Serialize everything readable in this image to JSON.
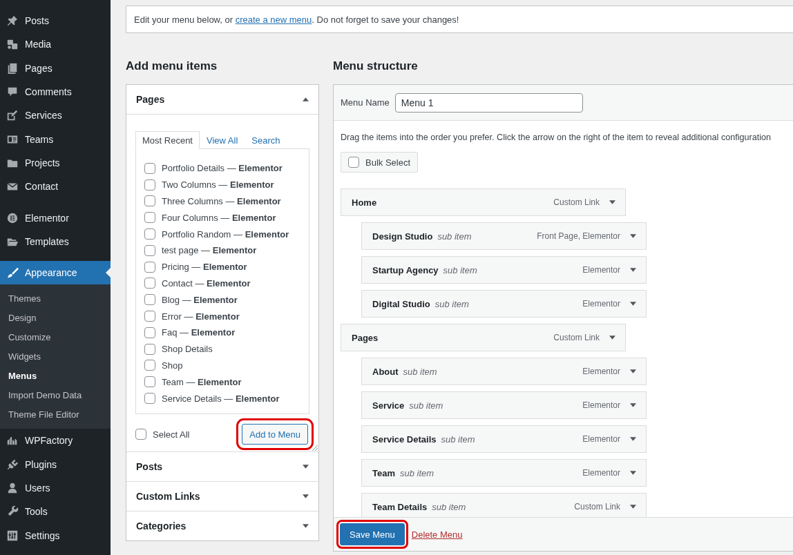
{
  "sidebar": {
    "groups": [
      {
        "items": [
          {
            "label": "Posts",
            "selected": false
          },
          {
            "label": "Media",
            "selected": false
          },
          {
            "label": "Pages",
            "selected": false
          },
          {
            "label": "Comments",
            "selected": false
          },
          {
            "label": "Services",
            "selected": false
          },
          {
            "label": "Teams",
            "selected": false
          },
          {
            "label": "Projects",
            "selected": false
          },
          {
            "label": "Contact",
            "selected": false
          }
        ]
      },
      {
        "items": [
          {
            "label": "Elementor",
            "selected": false
          },
          {
            "label": "Templates",
            "selected": false
          }
        ]
      },
      {
        "items": [
          {
            "label": "Appearance",
            "selected": true,
            "children": [
              {
                "label": "Themes",
                "selected": false
              },
              {
                "label": "Design",
                "selected": false
              },
              {
                "label": "Customize",
                "selected": false
              },
              {
                "label": "Widgets",
                "selected": false
              },
              {
                "label": "Menus",
                "selected": true
              },
              {
                "label": "Import Demo Data",
                "selected": false
              },
              {
                "label": "Theme File Editor",
                "selected": false
              }
            ]
          },
          {
            "label": "WPFactory",
            "selected": false
          },
          {
            "label": "Plugins",
            "selected": false
          },
          {
            "label": "Users",
            "selected": false
          },
          {
            "label": "Tools",
            "selected": false
          },
          {
            "label": "Settings",
            "selected": false
          }
        ]
      }
    ]
  },
  "notice": {
    "before": "Edit your menu below, or ",
    "link": "create a new menu",
    "after": ". Do not forget to save your changes!"
  },
  "add_items": {
    "title": "Add menu items",
    "sections": [
      {
        "title": "Pages",
        "expanded": true,
        "tabs": [
          {
            "label": "Most Recent",
            "selected": true
          },
          {
            "label": "View All",
            "selected": false
          },
          {
            "label": "Search",
            "selected": false
          }
        ],
        "items": [
          {
            "label": "Portfolio Details — **Elementor**",
            "checked": false
          },
          {
            "label": "Two Columns — **Elementor**",
            "checked": false
          },
          {
            "label": "Three Columns — **Elementor**",
            "checked": false
          },
          {
            "label": "Four Columns — **Elementor**",
            "checked": false
          },
          {
            "label": "Portfolio Random — **Elementor**",
            "checked": false
          },
          {
            "label": "test page — **Elementor**",
            "checked": false
          },
          {
            "label": "Pricing — **Elementor**",
            "checked": false
          },
          {
            "label": "Contact — **Elementor**",
            "checked": false
          },
          {
            "label": "Blog — **Elementor**",
            "checked": false
          },
          {
            "label": "Error — **Elementor**",
            "checked": false
          },
          {
            "label": "Faq — **Elementor**",
            "checked": false
          },
          {
            "label": "Shop Details",
            "checked": false
          },
          {
            "label": "Shop",
            "checked": false
          },
          {
            "label": "Team — **Elementor**",
            "checked": false
          },
          {
            "label": "Service Details — **Elementor**",
            "checked": false
          }
        ],
        "select_all": {
          "label": "Select All",
          "checked": false
        },
        "add_button": {
          "label": "Add to Menu",
          "highlighted": true
        }
      },
      {
        "title": "Posts",
        "expanded": false
      },
      {
        "title": "Custom Links",
        "expanded": false
      },
      {
        "title": "Categories",
        "expanded": false
      }
    ]
  },
  "structure": {
    "title": "Menu structure",
    "menu_name": {
      "label": "Menu Name",
      "value": "Menu 1"
    },
    "instructions": "Drag the items into the order you prefer. Click the arrow on the right of the item to reveal additional configuration",
    "bulk_select": {
      "label": "Bulk Select",
      "checked": false
    },
    "items": [
      {
        "title": "Home",
        "type": "Custom Link",
        "children": [
          {
            "title": "Design Studio",
            "note": "sub item",
            "type": "Front Page, Elementor"
          },
          {
            "title": "Startup Agency",
            "note": "sub item",
            "type": "Elementor"
          },
          {
            "title": "Digital Studio",
            "note": "sub item",
            "type": "Elementor"
          }
        ]
      },
      {
        "title": "Pages",
        "type": "Custom Link",
        "children": [
          {
            "title": "About",
            "note": "sub item",
            "type": "Elementor"
          },
          {
            "title": "Service",
            "note": "sub item",
            "type": "Elementor"
          },
          {
            "title": "Service Details",
            "note": "sub item",
            "type": "Elementor"
          },
          {
            "title": "Team",
            "note": "sub item",
            "type": "Elementor"
          },
          {
            "title": "Team Details",
            "note": "sub item",
            "type": "Custom Link"
          }
        ]
      }
    ],
    "save_button": {
      "label": "Save Menu",
      "highlighted": true
    },
    "delete_link": "Delete Menu"
  }
}
